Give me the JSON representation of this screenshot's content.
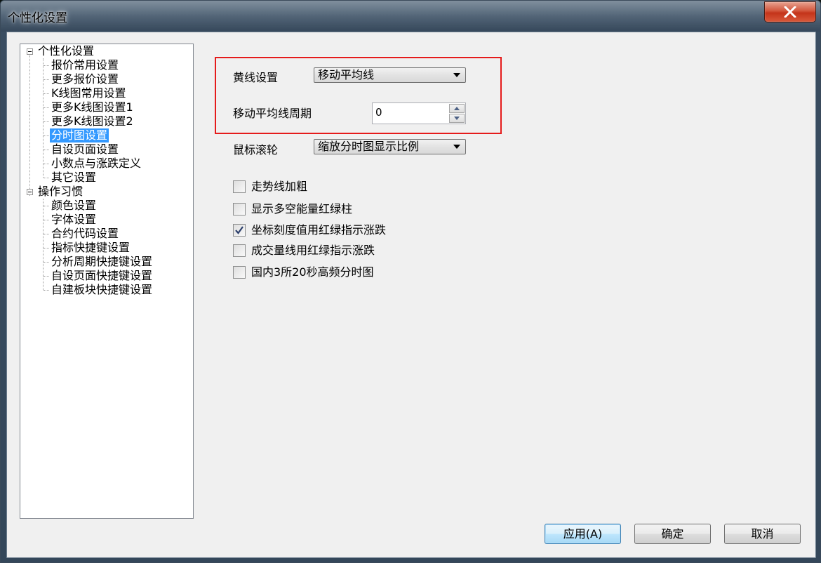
{
  "window": {
    "title": "个性化设置"
  },
  "tree": {
    "groups": [
      {
        "label": "个性化设置",
        "children": [
          "报价常用设置",
          "更多报价设置",
          "K线图常用设置",
          "更多K线图设置1",
          "更多K线图设置2",
          "分时图设置",
          "自设页面设置",
          "小数点与涨跌定义",
          "其它设置"
        ]
      },
      {
        "label": "操作习惯",
        "children": [
          "颜色设置",
          "字体设置",
          "合约代码设置",
          "指标快捷键设置",
          "分析周期快捷键设置",
          "自设页面快捷键设置",
          "自建板块快捷键设置"
        ]
      }
    ],
    "selected": "分时图设置"
  },
  "settings": {
    "yellow_line": {
      "label": "黄线设置",
      "value": "移动平均线"
    },
    "ma_period": {
      "label": "移动平均线周期",
      "value": "0"
    },
    "mouse_wheel": {
      "label": "鼠标滚轮",
      "value": "缩放分时图显示比例"
    },
    "checkboxes": [
      {
        "label": "走势线加粗",
        "checked": false
      },
      {
        "label": "显示多空能量红绿柱",
        "checked": false
      },
      {
        "label": "坐标刻度值用红绿指示涨跌",
        "checked": true
      },
      {
        "label": "成交量线用红绿指示涨跌",
        "checked": false
      },
      {
        "label": "国内3所20秒高频分时图",
        "checked": false
      }
    ]
  },
  "buttons": {
    "apply": "应用(A)",
    "ok": "确定",
    "cancel": "取消"
  },
  "colors": {
    "selection": "#3399ff",
    "highlight_border": "#e51b1b",
    "close_button": "#c4341a"
  }
}
